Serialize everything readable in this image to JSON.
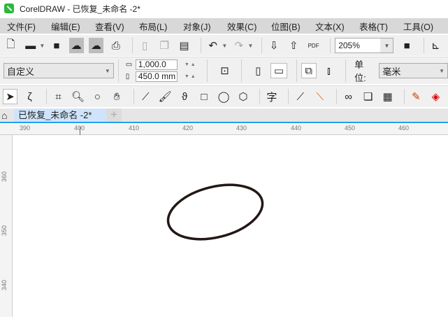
{
  "window": {
    "title": "CorelDRAW - 已恢复_未命名 -2*"
  },
  "menu": [
    "文件(F)",
    "编辑(E)",
    "查看(V)",
    "布局(L)",
    "对象(J)",
    "效果(C)",
    "位图(B)",
    "文本(X)",
    "表格(T)",
    "工具(O)"
  ],
  "toolbar": {
    "zoom": "205%",
    "pdf_label": "PDF"
  },
  "property_bar": {
    "page_size": "自定义",
    "width": "1,000.0 mm",
    "height": "450.0 mm",
    "units_label": "单位:",
    "units": "毫米"
  },
  "tabs": [
    {
      "label": "已恢复_未命名 -2*"
    }
  ],
  "ruler": {
    "h": [
      "390",
      "400",
      "410",
      "420",
      "430",
      "440",
      "450",
      "460"
    ],
    "v": [
      "360",
      "350",
      "340"
    ]
  }
}
